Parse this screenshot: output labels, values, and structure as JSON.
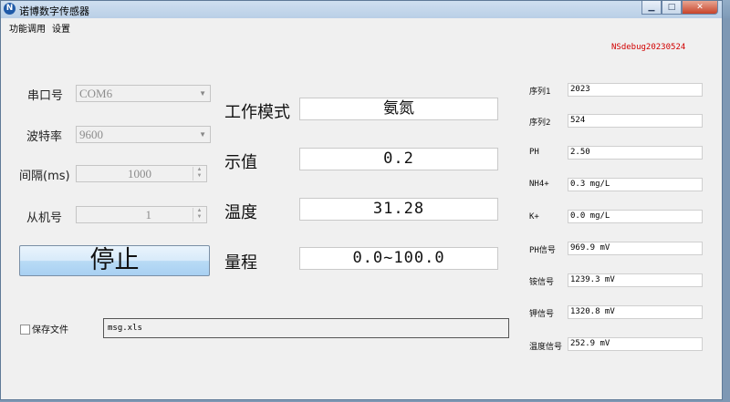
{
  "window": {
    "title": "诺博数字传感器",
    "icon": "app-logo-icon"
  },
  "menu": {
    "items": [
      "功能调用",
      "设置"
    ]
  },
  "version": "NSdebug20230524",
  "serial": {
    "port_label": "串口号",
    "port_value": "COM6",
    "baud_label": "波特率",
    "baud_value": "9600",
    "interval_label": "间隔(ms)",
    "interval_value": "1000",
    "slave_label": "从机号",
    "slave_value": "1"
  },
  "stop_button": "停止",
  "readings": {
    "mode_label": "工作模式",
    "mode_value": "氨氮",
    "display_label": "示值",
    "display_value": "0.2",
    "temp_label": "温度",
    "temp_value": "31.28",
    "range_label": "量程",
    "range_value": "0.0~100.0"
  },
  "save": {
    "checkbox_label": "保存文件",
    "checked": false,
    "filename": "msg.xls"
  },
  "right_panel": [
    {
      "label": "序列1",
      "value": "2023"
    },
    {
      "label": "序列2",
      "value": "524"
    },
    {
      "label": "PH",
      "value": "2.50"
    },
    {
      "label": "NH4+",
      "value": "0.3 mg/L"
    },
    {
      "label": "K+",
      "value": "0.0 mg/L"
    },
    {
      "label": "PH信号",
      "value": "969.9 mV"
    },
    {
      "label": "铵信号",
      "value": "1239.3 mV"
    },
    {
      "label": "钾信号",
      "value": "1320.8 mV"
    },
    {
      "label": "温度信号",
      "value": "252.9 mV"
    }
  ],
  "colors": {
    "version_text": "#d10000",
    "titlebar": "#c4d7ec",
    "window_bg": "#f0f0f0"
  }
}
